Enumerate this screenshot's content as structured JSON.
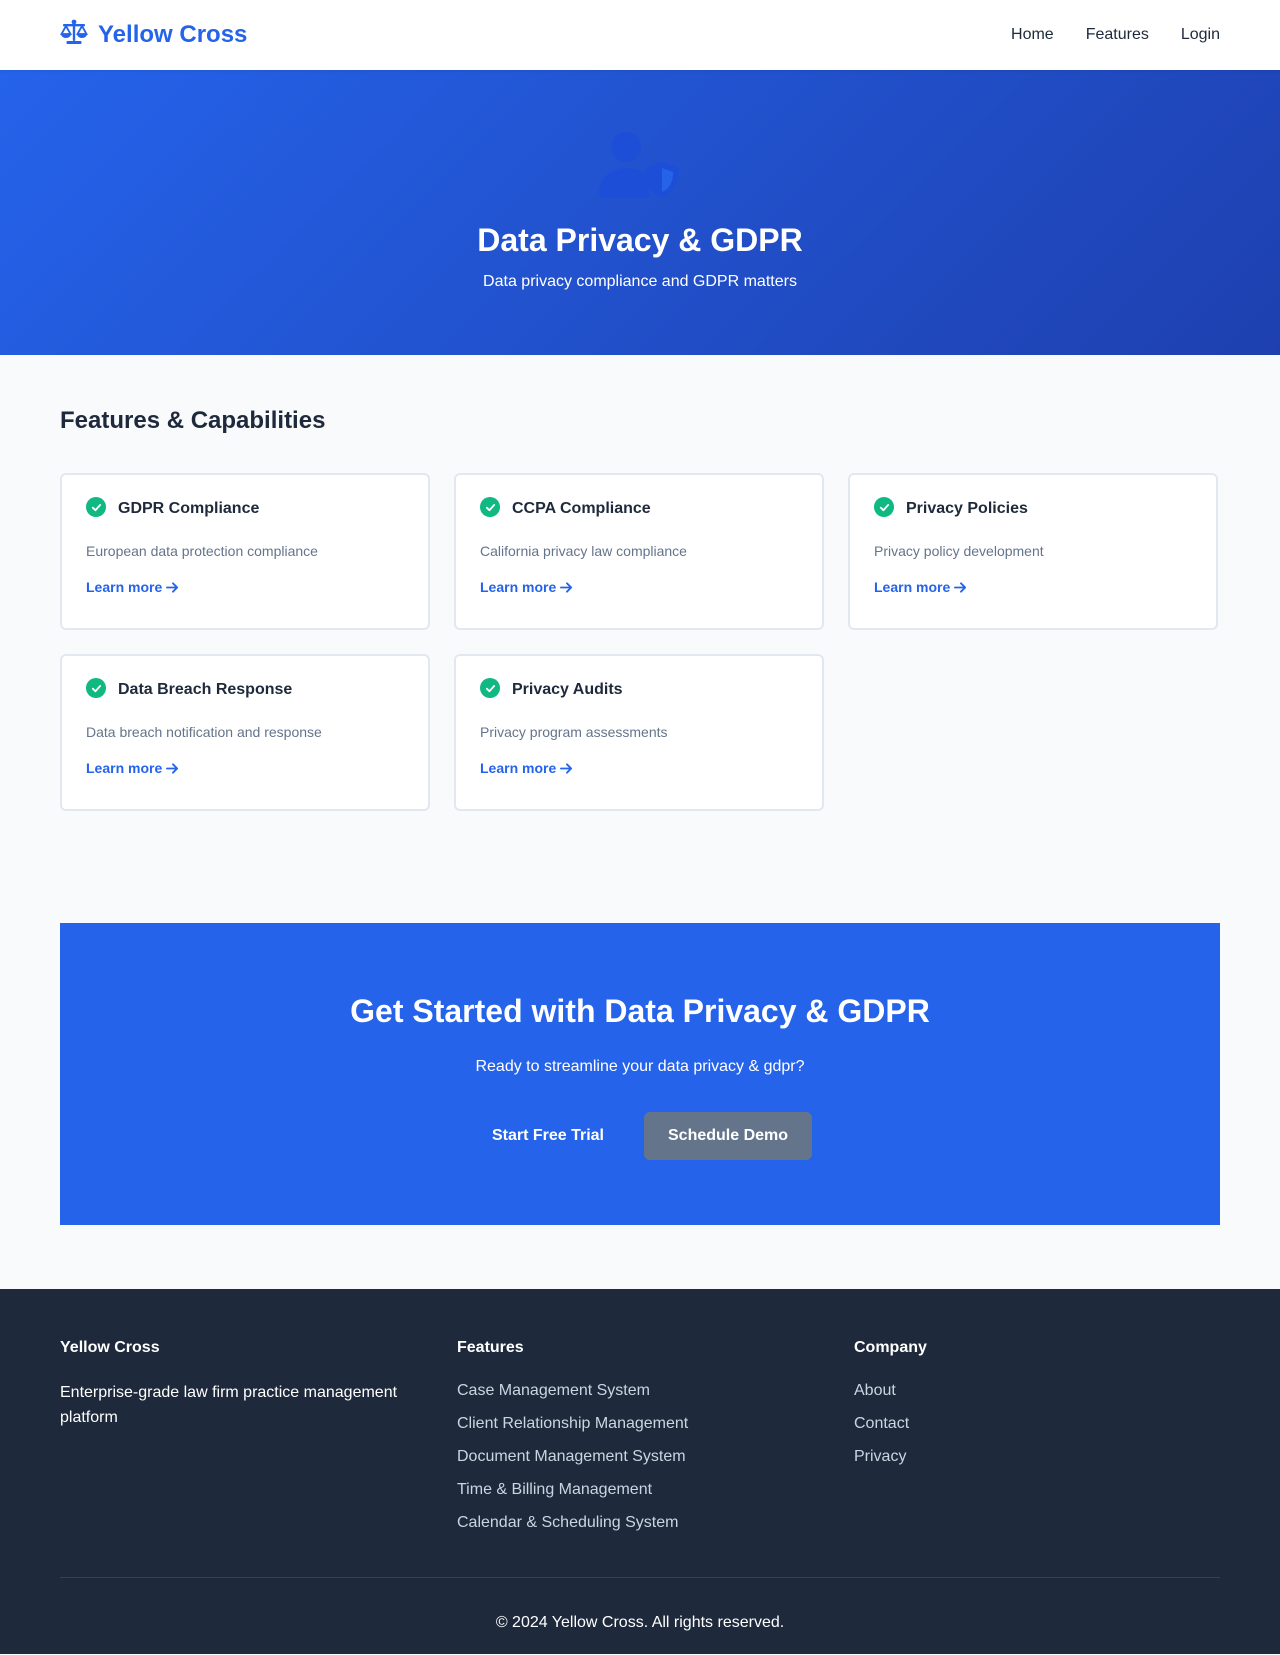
{
  "brand": {
    "name": "Yellow Cross",
    "icon": "scale-balance-icon",
    "color": "#2563eb"
  },
  "nav": {
    "home": "Home",
    "features": "Features",
    "login": "Login"
  },
  "hero": {
    "icon": "user-shield-icon",
    "title": "Data Privacy & GDPR",
    "subtitle": "Data privacy compliance and GDPR matters"
  },
  "features": {
    "heading": "Features & Capabilities",
    "cards": [
      {
        "title": "GDPR Compliance",
        "description": "European data protection compliance",
        "link": "Learn more"
      },
      {
        "title": "CCPA Compliance",
        "description": "California privacy law compliance",
        "link": "Learn more"
      },
      {
        "title": "Privacy Policies",
        "description": "Privacy policy development",
        "link": "Learn more"
      },
      {
        "title": "Data Breach Response",
        "description": "Data breach notification and response",
        "link": "Learn more"
      },
      {
        "title": "Privacy Audits",
        "description": "Privacy program assessments",
        "link": "Learn more"
      }
    ]
  },
  "cta": {
    "title": "Get Started with Data Privacy & GDPR",
    "subtitle": "Ready to streamline your data privacy & gdpr?",
    "primary_button": "Start Free Trial",
    "secondary_button": "Schedule Demo"
  },
  "footer": {
    "about": {
      "heading": "Yellow Cross",
      "text": "Enterprise-grade law firm practice management platform"
    },
    "features": {
      "heading": "Features",
      "links": [
        "Case Management System",
        "Client Relationship Management",
        "Document Management System",
        "Time & Billing Management",
        "Calendar & Scheduling System"
      ]
    },
    "company": {
      "heading": "Company",
      "links": [
        "About",
        "Contact",
        "Privacy"
      ]
    },
    "copyright": "© 2024 Yellow Cross. All rights reserved."
  },
  "colors": {
    "primary": "#2563eb",
    "primary_dark": "#1e40af",
    "success": "#10b981",
    "footer_bg": "#1e293b",
    "secondary_button": "#64748b"
  }
}
